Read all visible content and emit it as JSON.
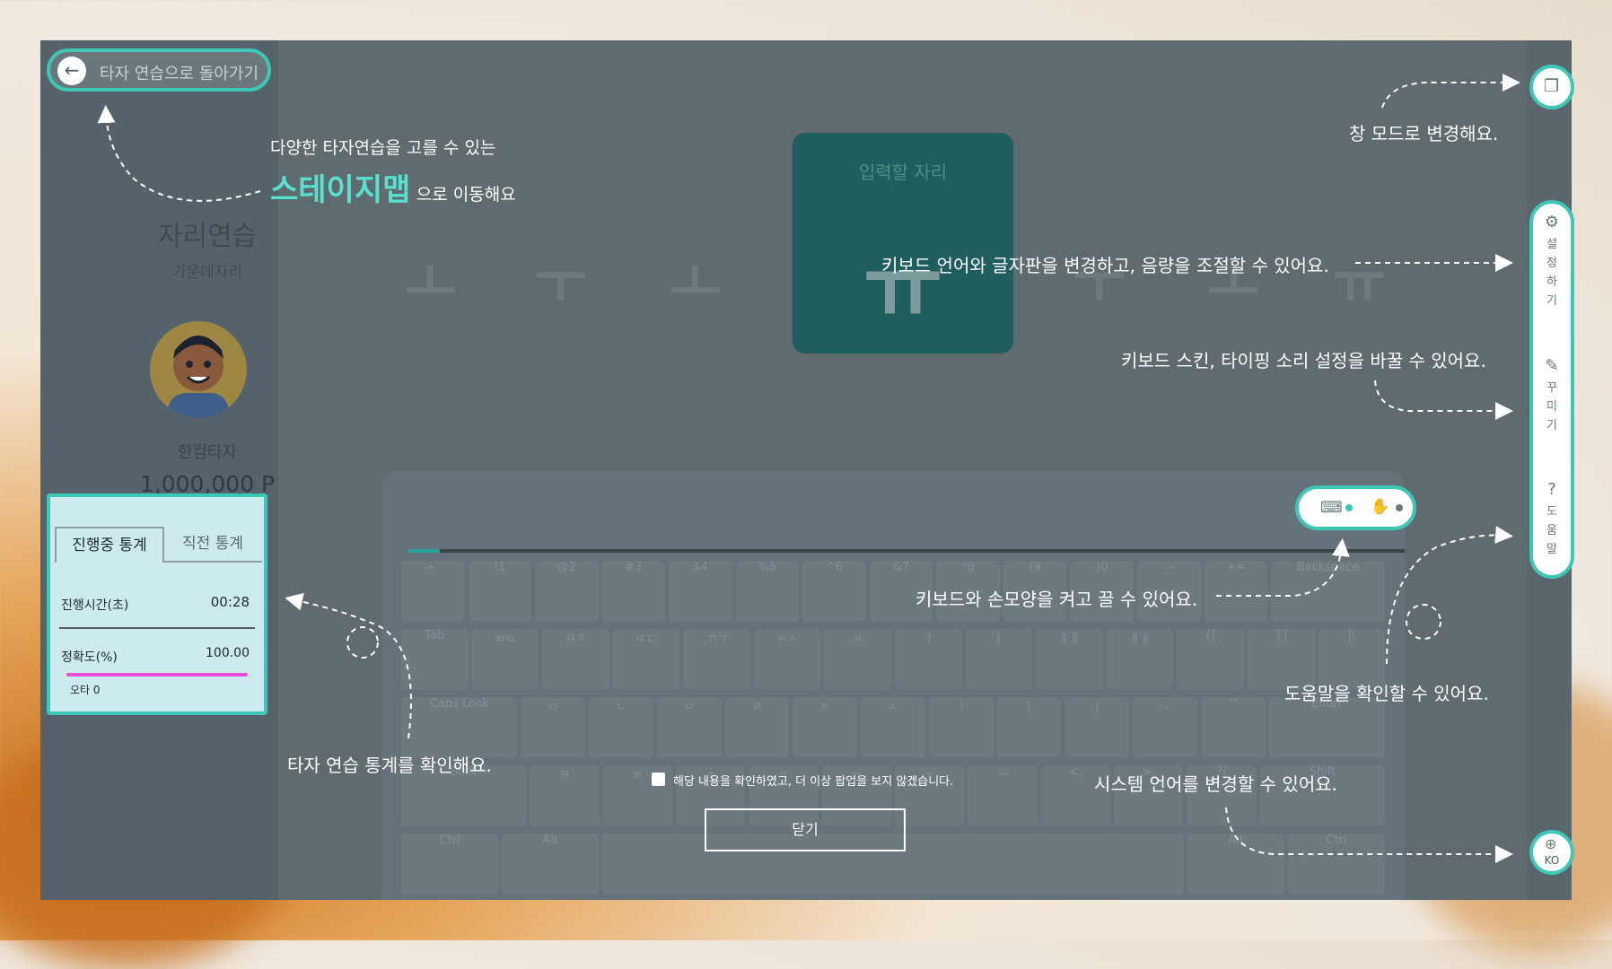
{
  "back_button": {
    "label": "타자 연습으로 돌아가기",
    "icon": "arrow-left-icon"
  },
  "sidebar": {
    "stage_title": "자리연습",
    "stage_subtitle": "가운데자리",
    "user_name": "한컴타자",
    "points": "1,000,000 P"
  },
  "stats": {
    "tabs": [
      "진행중 통계",
      "직전 통계"
    ],
    "time_label": "진행시간(초)",
    "time_value": "00:28",
    "accuracy_label": "정확도(%)",
    "accuracy_value": "100.00",
    "accuracy_fraction": 1.0,
    "typo_label": "오타 0"
  },
  "practice": {
    "target_label": "입력할 자리",
    "target_char": "ㅠ",
    "ghost_chars": [
      "ㅗ",
      "ㅜ",
      "ㅗ",
      "ㅜ",
      "ㅗ",
      "ㅠ"
    ]
  },
  "keyboard": {
    "row1": [
      "~`",
      "!1",
      "@2",
      "#3",
      "$4",
      "%5",
      "^6",
      "&7",
      "*8",
      "(9",
      ")0",
      "_-",
      "+=",
      "Backspace"
    ],
    "row2": [
      "Tab",
      "ㅃㅂ",
      "ㅉㅈ",
      "ㄸㄷ",
      "ㄲㄱ",
      "ㅆㅅ",
      "ㅛ",
      "ㅕ",
      "ㅑ",
      "ㅒㅐ",
      "ㅖㅔ",
      "{[",
      "}]",
      "|\\"
    ],
    "row3": [
      "Caps Lock",
      "ㅁ",
      "ㄴ",
      "ㅇ",
      "ㄹ",
      "ㅎ",
      "ㅗ",
      "ㅓ",
      "ㅏ",
      "ㅣ",
      ":;",
      "\"'",
      "Enter"
    ],
    "row4": [
      "Shift",
      "ㅋ",
      "ㅌ",
      "ㅊ",
      "ㅍ",
      "ㅠ",
      "ㅜ",
      "ㅡ",
      "<,",
      ">.",
      "?/",
      "Shift"
    ],
    "row5": [
      "Ctrl",
      "Alt",
      "",
      "Alt",
      "Ctrl"
    ]
  },
  "annotations": {
    "stagemap_line1": "다양한 타자연습을 고를 수 있는",
    "stagemap_strong": "스테이지맵",
    "stagemap_line2": "으로 이동해요",
    "window_mode": "창 모드로 변경해요.",
    "settings": "키보드 언어와 글자판을 변경하고, 음량을 조절할 수 있어요.",
    "decorate": "키보드 스킨, 타이핑 소리 설정을 바꿀 수 있어요.",
    "keyboard_toggle": "키보드와 손모양을 켜고 끌 수 있어요.",
    "help": "도움말을 확인할 수 있어요.",
    "stats": "타자 연습 통계를 확인해요.",
    "language": "시스템 언어를 변경할 수 있어요."
  },
  "rail": {
    "settings": "설정하기",
    "decorate": "꾸미기",
    "help": "도움말",
    "language": "KO"
  },
  "popup": {
    "dont_show_again": "해당 내용을 확인하였고, 더 이상 팝업을 보지 않겠습니다.",
    "close": "닫기"
  },
  "colors": {
    "accent": "#3ec6b7",
    "highlight": "#58e0d1",
    "accuracy_bar": "#e84fd6",
    "overlay": "#5f6b6f"
  }
}
